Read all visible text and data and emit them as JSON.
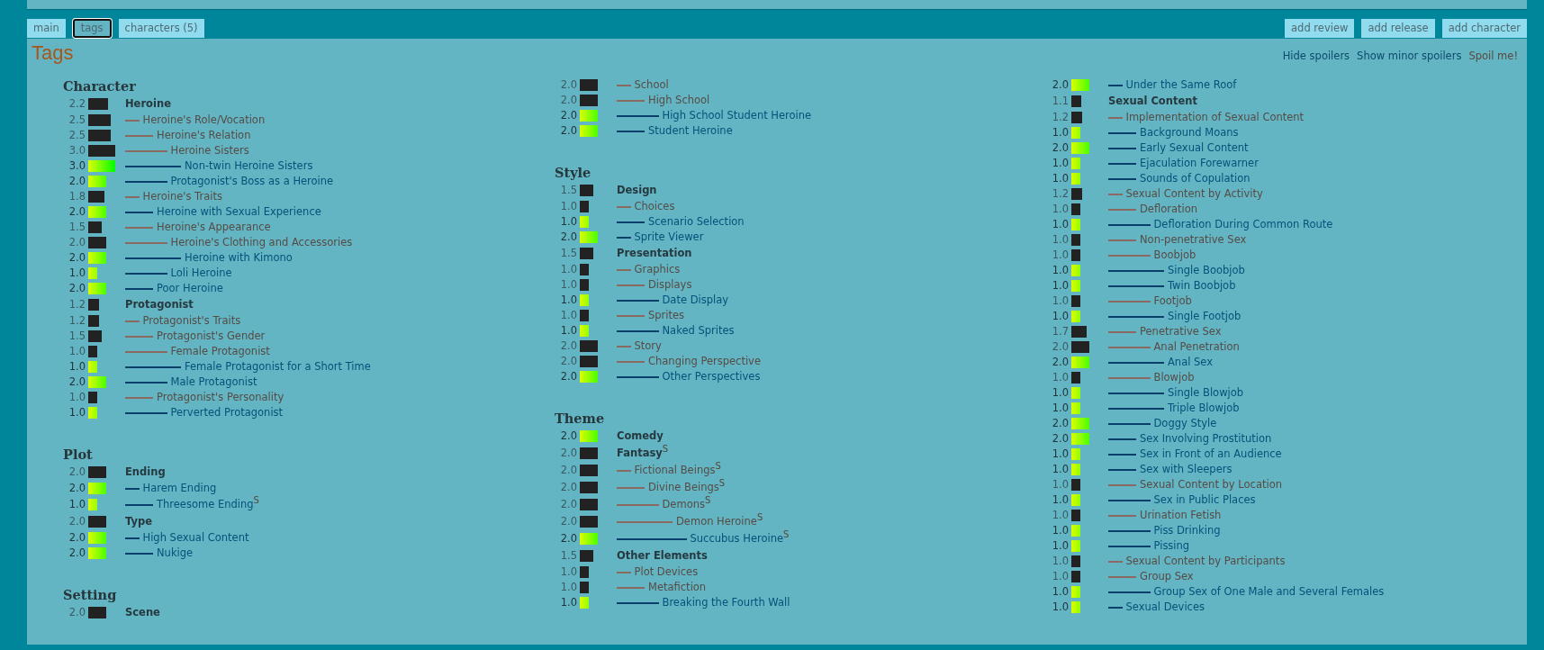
{
  "tabs": [
    {
      "label": "main",
      "selected": false
    },
    {
      "label": "tags",
      "selected": true
    },
    {
      "label": "characters (5)",
      "selected": false
    }
  ],
  "actions": [
    "add review",
    "add release",
    "add character"
  ],
  "title": "Tags",
  "spoiler_options": [
    {
      "label": "Hide spoilers",
      "selected": false
    },
    {
      "label": "Show minor spoilers",
      "selected": false
    },
    {
      "label": "Spoil me!",
      "selected": true
    }
  ],
  "columns": [
    {
      "sections": [
        {
          "category": "Character",
          "continued": false,
          "tags": [
            {
              "score": "2.2",
              "level": 0.73,
              "voted": false,
              "name": "Heroine",
              "children": [
                {
                  "score": "2.5",
                  "level": 0.83,
                  "voted": false,
                  "name": "Heroine's Role/Vocation",
                  "children": [
                    {
                      "score": "2.5",
                      "level": 0.83,
                      "voted": false,
                      "name": "Heroine's Relation",
                      "children": [
                        {
                          "score": "3.0",
                          "level": 1,
                          "voted": false,
                          "name": "Heroine Sisters",
                          "children": [
                            {
                              "score": "3.0",
                              "level": 1,
                              "voted": true,
                              "name": "Non-twin Heroine Sisters"
                            }
                          ]
                        },
                        {
                          "score": "2.0",
                          "level": 0.67,
                          "voted": true,
                          "name": "Protagonist's Boss as a Heroine"
                        }
                      ]
                    }
                  ]
                },
                {
                  "score": "1.8",
                  "level": 0.6,
                  "voted": false,
                  "name": "Heroine's Traits",
                  "children": [
                    {
                      "score": "2.0",
                      "level": 0.67,
                      "voted": true,
                      "name": "Heroine with Sexual Experience"
                    },
                    {
                      "score": "1.5",
                      "level": 0.5,
                      "voted": false,
                      "name": "Heroine's Appearance",
                      "children": [
                        {
                          "score": "2.0",
                          "level": 0.67,
                          "voted": false,
                          "name": "Heroine's Clothing and Accessories",
                          "children": [
                            {
                              "score": "2.0",
                              "level": 0.67,
                              "voted": true,
                              "name": "Heroine with Kimono"
                            }
                          ]
                        },
                        {
                          "score": "1.0",
                          "level": 0.33,
                          "voted": true,
                          "name": "Loli Heroine"
                        }
                      ]
                    },
                    {
                      "score": "2.0",
                      "level": 0.67,
                      "voted": true,
                      "name": "Poor Heroine"
                    }
                  ]
                }
              ]
            },
            {
              "score": "1.2",
              "level": 0.4,
              "voted": false,
              "name": "Protagonist",
              "children": [
                {
                  "score": "1.2",
                  "level": 0.4,
                  "voted": false,
                  "name": "Protagonist's Traits",
                  "children": [
                    {
                      "score": "1.5",
                      "level": 0.5,
                      "voted": false,
                      "name": "Protagonist's Gender",
                      "children": [
                        {
                          "score": "1.0",
                          "level": 0.33,
                          "voted": false,
                          "name": "Female Protagonist",
                          "children": [
                            {
                              "score": "1.0",
                              "level": 0.33,
                              "voted": true,
                              "name": "Female Protagonist for a Short Time"
                            }
                          ]
                        },
                        {
                          "score": "2.0",
                          "level": 0.67,
                          "voted": true,
                          "name": "Male Protagonist"
                        }
                      ]
                    },
                    {
                      "score": "1.0",
                      "level": 0.33,
                      "voted": false,
                      "name": "Protagonist's Personality",
                      "children": [
                        {
                          "score": "1.0",
                          "level": 0.33,
                          "voted": true,
                          "name": "Perverted Protagonist"
                        }
                      ]
                    }
                  ]
                }
              ]
            }
          ]
        },
        {
          "category": "Plot",
          "continued": false,
          "tags": [
            {
              "score": "2.0",
              "level": 0.67,
              "voted": false,
              "name": "Ending",
              "children": [
                {
                  "score": "2.0",
                  "level": 0.67,
                  "voted": true,
                  "name": "Harem Ending",
                  "children": [
                    {
                      "score": "1.0",
                      "level": 0.33,
                      "voted": true,
                      "name": "Threesome Ending",
                      "spoiler_mark": "S"
                    }
                  ]
                }
              ]
            },
            {
              "score": "2.0",
              "level": 0.67,
              "voted": false,
              "name": "Type",
              "children": [
                {
                  "score": "2.0",
                  "level": 0.67,
                  "voted": true,
                  "name": "High Sexual Content",
                  "children": [
                    {
                      "score": "2.0",
                      "level": 0.67,
                      "voted": true,
                      "name": "Nukige"
                    }
                  ]
                }
              ]
            }
          ]
        },
        {
          "category": "Setting",
          "continued": false,
          "tags": [
            {
              "score": "2.0",
              "level": 0.67,
              "voted": false,
              "name": "Scene"
            }
          ]
        }
      ]
    },
    {
      "sections": [
        {
          "continued": true,
          "tags": [
            {
              "score": "2.0",
              "level": 0.67,
              "voted": false,
              "name": "School",
              "children": [
                {
                  "score": "2.0",
                  "level": 0.67,
                  "voted": false,
                  "name": "High School",
                  "children": [
                    {
                      "score": "2.0",
                      "level": 0.67,
                      "voted": true,
                      "name": "High School Student Heroine"
                    }
                  ]
                },
                {
                  "score": "2.0",
                  "level": 0.67,
                  "voted": true,
                  "name": "Student Heroine"
                }
              ]
            }
          ]
        },
        {
          "category": "Style",
          "continued": false,
          "tags": [
            {
              "score": "1.5",
              "level": 0.5,
              "voted": false,
              "name": "Design",
              "children": [
                {
                  "score": "1.0",
                  "level": 0.33,
                  "voted": false,
                  "name": "Choices",
                  "children": [
                    {
                      "score": "1.0",
                      "level": 0.33,
                      "voted": true,
                      "name": "Scenario Selection"
                    }
                  ]
                },
                {
                  "score": "2.0",
                  "level": 0.67,
                  "voted": true,
                  "name": "Sprite Viewer"
                }
              ]
            },
            {
              "score": "1.5",
              "level": 0.5,
              "voted": false,
              "name": "Presentation",
              "children": [
                {
                  "score": "1.0",
                  "level": 0.33,
                  "voted": false,
                  "name": "Graphics",
                  "children": [
                    {
                      "score": "1.0",
                      "level": 0.33,
                      "voted": false,
                      "name": "Displays",
                      "children": [
                        {
                          "score": "1.0",
                          "level": 0.33,
                          "voted": true,
                          "name": "Date Display"
                        }
                      ]
                    },
                    {
                      "score": "1.0",
                      "level": 0.33,
                      "voted": false,
                      "name": "Sprites",
                      "children": [
                        {
                          "score": "1.0",
                          "level": 0.33,
                          "voted": true,
                          "name": "Naked Sprites"
                        }
                      ]
                    }
                  ]
                },
                {
                  "score": "2.0",
                  "level": 0.67,
                  "voted": false,
                  "name": "Story",
                  "children": [
                    {
                      "score": "2.0",
                      "level": 0.67,
                      "voted": false,
                      "name": "Changing Perspective",
                      "children": [
                        {
                          "score": "2.0",
                          "level": 0.67,
                          "voted": true,
                          "name": "Other Perspectives"
                        }
                      ]
                    }
                  ]
                }
              ]
            }
          ]
        },
        {
          "category": "Theme",
          "continued": false,
          "tags": [
            {
              "score": "2.0",
              "level": 0.67,
              "voted": true,
              "name": "Comedy"
            },
            {
              "score": "2.0",
              "level": 0.67,
              "voted": false,
              "name": "Fantasy",
              "spoiler_mark": "S",
              "children": [
                {
                  "score": "2.0",
                  "level": 0.67,
                  "voted": false,
                  "name": "Fictional Beings",
                  "spoiler_mark": "S",
                  "children": [
                    {
                      "score": "2.0",
                      "level": 0.67,
                      "voted": false,
                      "name": "Divine Beings",
                      "spoiler_mark": "S",
                      "children": [
                        {
                          "score": "2.0",
                          "level": 0.67,
                          "voted": false,
                          "name": "Demons",
                          "spoiler_mark": "S",
                          "children": [
                            {
                              "score": "2.0",
                              "level": 0.67,
                              "voted": false,
                              "name": "Demon Heroine",
                              "spoiler_mark": "S",
                              "children": [
                                {
                                  "score": "2.0",
                                  "level": 0.67,
                                  "voted": true,
                                  "name": "Succubus Heroine",
                                  "spoiler_mark": "S"
                                }
                              ]
                            }
                          ]
                        }
                      ]
                    }
                  ]
                }
              ]
            },
            {
              "score": "1.5",
              "level": 0.5,
              "voted": false,
              "name": "Other Elements",
              "children": [
                {
                  "score": "1.0",
                  "level": 0.33,
                  "voted": false,
                  "name": "Plot Devices",
                  "children": [
                    {
                      "score": "1.0",
                      "level": 0.33,
                      "voted": false,
                      "name": "Metafiction",
                      "children": [
                        {
                          "score": "1.0",
                          "level": 0.33,
                          "voted": true,
                          "name": "Breaking the Fourth Wall"
                        }
                      ]
                    }
                  ]
                }
              ]
            }
          ]
        }
      ]
    },
    {
      "sections": [
        {
          "continued": true,
          "tags": [
            {
              "score": "2.0",
              "level": 0.67,
              "voted": true,
              "name": "Under the Same Roof"
            }
          ]
        },
        {
          "continued": false,
          "tags": [
            {
              "score": "1.1",
              "level": 0.37,
              "voted": false,
              "name": "Sexual Content",
              "children": [
                {
                  "score": "1.2",
                  "level": 0.4,
                  "voted": false,
                  "name": "Implementation of Sexual Content",
                  "children": [
                    {
                      "score": "1.0",
                      "level": 0.33,
                      "voted": true,
                      "name": "Background Moans"
                    },
                    {
                      "score": "2.0",
                      "level": 0.67,
                      "voted": true,
                      "name": "Early Sexual Content"
                    },
                    {
                      "score": "1.0",
                      "level": 0.33,
                      "voted": true,
                      "name": "Ejaculation Forewarner"
                    },
                    {
                      "score": "1.0",
                      "level": 0.33,
                      "voted": true,
                      "name": "Sounds of Copulation"
                    }
                  ]
                },
                {
                  "score": "1.2",
                  "level": 0.4,
                  "voted": false,
                  "name": "Sexual Content by Activity",
                  "children": [
                    {
                      "score": "1.0",
                      "level": 0.33,
                      "voted": false,
                      "name": "Defloration",
                      "children": [
                        {
                          "score": "1.0",
                          "level": 0.33,
                          "voted": true,
                          "name": "Defloration During Common Route"
                        }
                      ]
                    },
                    {
                      "score": "1.0",
                      "level": 0.33,
                      "voted": false,
                      "name": "Non-penetrative Sex",
                      "children": [
                        {
                          "score": "1.0",
                          "level": 0.33,
                          "voted": false,
                          "name": "Boobjob",
                          "children": [
                            {
                              "score": "1.0",
                              "level": 0.33,
                              "voted": true,
                              "name": "Single Boobjob"
                            },
                            {
                              "score": "1.0",
                              "level": 0.33,
                              "voted": true,
                              "name": "Twin Boobjob"
                            }
                          ]
                        },
                        {
                          "score": "1.0",
                          "level": 0.33,
                          "voted": false,
                          "name": "Footjob",
                          "children": [
                            {
                              "score": "1.0",
                              "level": 0.33,
                              "voted": true,
                              "name": "Single Footjob"
                            }
                          ]
                        }
                      ]
                    },
                    {
                      "score": "1.7",
                      "level": 0.57,
                      "voted": false,
                      "name": "Penetrative Sex",
                      "children": [
                        {
                          "score": "2.0",
                          "level": 0.67,
                          "voted": false,
                          "name": "Anal Penetration",
                          "children": [
                            {
                              "score": "2.0",
                              "level": 0.67,
                              "voted": true,
                              "name": "Anal Sex"
                            }
                          ]
                        },
                        {
                          "score": "1.0",
                          "level": 0.33,
                          "voted": false,
                          "name": "Blowjob",
                          "children": [
                            {
                              "score": "1.0",
                              "level": 0.33,
                              "voted": true,
                              "name": "Single Blowjob"
                            },
                            {
                              "score": "1.0",
                              "level": 0.33,
                              "voted": true,
                              "name": "Triple Blowjob"
                            }
                          ]
                        },
                        {
                          "score": "2.0",
                          "level": 0.67,
                          "voted": true,
                          "name": "Doggy Style"
                        }
                      ]
                    },
                    {
                      "score": "2.0",
                      "level": 0.67,
                      "voted": true,
                      "name": "Sex Involving Prostitution"
                    },
                    {
                      "score": "1.0",
                      "level": 0.33,
                      "voted": true,
                      "name": "Sex in Front of an Audience"
                    },
                    {
                      "score": "1.0",
                      "level": 0.33,
                      "voted": true,
                      "name": "Sex with Sleepers"
                    },
                    {
                      "score": "1.0",
                      "level": 0.33,
                      "voted": false,
                      "name": "Sexual Content by Location",
                      "children": [
                        {
                          "score": "1.0",
                          "level": 0.33,
                          "voted": true,
                          "name": "Sex in Public Places"
                        }
                      ]
                    },
                    {
                      "score": "1.0",
                      "level": 0.33,
                      "voted": false,
                      "name": "Urination Fetish",
                      "children": [
                        {
                          "score": "1.0",
                          "level": 0.33,
                          "voted": true,
                          "name": "Piss Drinking"
                        },
                        {
                          "score": "1.0",
                          "level": 0.33,
                          "voted": true,
                          "name": "Pissing"
                        }
                      ]
                    }
                  ]
                },
                {
                  "score": "1.0",
                  "level": 0.33,
                  "voted": false,
                  "name": "Sexual Content by Participants",
                  "children": [
                    {
                      "score": "1.0",
                      "level": 0.33,
                      "voted": false,
                      "name": "Group Sex",
                      "children": [
                        {
                          "score": "1.0",
                          "level": 0.33,
                          "voted": true,
                          "name": "Group Sex of One Male and Several Females"
                        }
                      ]
                    }
                  ]
                },
                {
                  "score": "1.0",
                  "level": 0.33,
                  "voted": true,
                  "name": "Sexual Devices"
                }
              ]
            }
          ]
        }
      ]
    }
  ]
}
